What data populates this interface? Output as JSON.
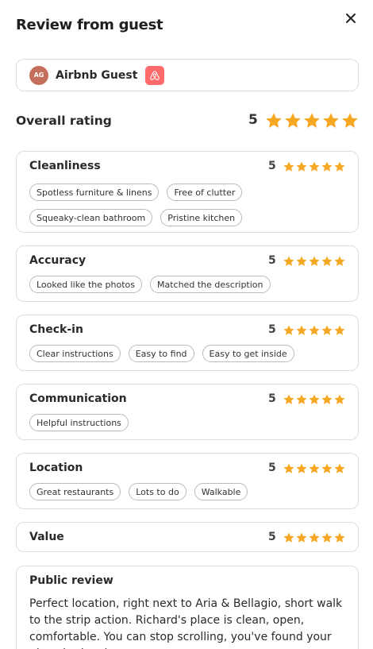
{
  "header": {
    "title": "Review from guest"
  },
  "guest": {
    "initials": "AG",
    "name": "Airbnb Guest"
  },
  "overall": {
    "label": "Overall rating",
    "score": "5",
    "stars": 5
  },
  "categories": [
    {
      "name": "Cleanliness",
      "score": "5",
      "stars": 5,
      "tags": [
        "Spotless furniture & linens",
        "Free of clutter",
        "Squeaky-clean bathroom",
        "Pristine kitchen"
      ]
    },
    {
      "name": "Accuracy",
      "score": "5",
      "stars": 5,
      "tags": [
        "Looked like the photos",
        "Matched the description"
      ]
    },
    {
      "name": "Check-in",
      "score": "5",
      "stars": 5,
      "tags": [
        "Clear instructions",
        "Easy to find",
        "Easy to get inside"
      ]
    },
    {
      "name": "Communication",
      "score": "5",
      "stars": 5,
      "tags": [
        "Helpful instructions"
      ]
    },
    {
      "name": "Location",
      "score": "5",
      "stars": 5,
      "tags": [
        "Great restaurants",
        "Lots to do",
        "Walkable"
      ]
    },
    {
      "name": "Value",
      "score": "5",
      "stars": 5,
      "tags": []
    }
  ],
  "public_review": {
    "title": "Public review",
    "text": "Perfect location, right next to Aria & Bellagio, short walk to the strip action. Richard's place is clean, open, comfortable. You can stop scrolling, you've found your place in the city."
  },
  "colors": {
    "star": "#f7a823",
    "airbnb": "#ff6b6b",
    "avatar": "#c46f5c",
    "border": "#dddddd"
  },
  "icons": {
    "close": "close-icon",
    "airbnb": "airbnb-logo-icon",
    "star": "star-icon"
  }
}
